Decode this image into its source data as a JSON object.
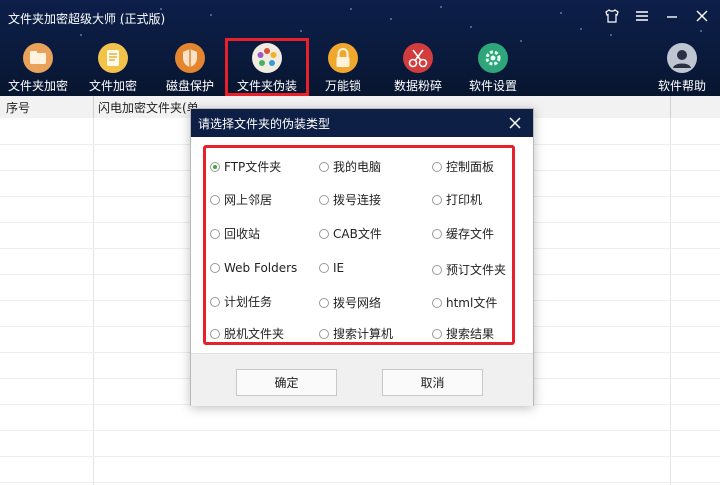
{
  "window": {
    "title": "文件夹加密超级大师 (正式版)",
    "controls": [
      {
        "name": "skin-icon"
      },
      {
        "name": "menu-icon"
      },
      {
        "name": "minimize-icon"
      },
      {
        "name": "close-icon"
      }
    ]
  },
  "toolbar": {
    "items": [
      {
        "label": "文件夹加密",
        "icon": "folder-lock-icon",
        "color": "#e9a25a"
      },
      {
        "label": "文件加密",
        "icon": "file-lock-icon",
        "color": "#f2c24a"
      },
      {
        "label": "磁盘保护",
        "icon": "disk-shield-icon",
        "color": "#e4852f"
      },
      {
        "label": "文件夹伪装",
        "icon": "folder-disguise-icon",
        "color": "#f0ece0",
        "active": true
      },
      {
        "label": "万能锁",
        "icon": "padlock-icon",
        "color": "#f0a72e"
      },
      {
        "label": "数据粉碎",
        "icon": "shredder-icon",
        "color": "#d33c3c"
      },
      {
        "label": "软件设置",
        "icon": "gear-icon",
        "color": "#2fa57a"
      },
      {
        "label": "软件帮助",
        "icon": "user-help-icon",
        "color": "#bfc6d2"
      }
    ],
    "active_outline_color": "#e8202a"
  },
  "table": {
    "headers": [
      "序号",
      "闪电加密文件夹(单"
    ]
  },
  "dialog": {
    "title": "请选择文件夹的伪装类型",
    "options": [
      [
        "FTP文件夹",
        "我的电脑",
        "控制面板"
      ],
      [
        "网上邻居",
        "拨号连接",
        "打印机"
      ],
      [
        "回收站",
        "CAB文件",
        "缓存文件"
      ],
      [
        "Web Folders",
        "IE",
        "预订文件夹"
      ],
      [
        "计划任务",
        "拨号网络",
        "html文件"
      ],
      [
        "脱机文件夹",
        "搜索计算机",
        "搜索结果"
      ]
    ],
    "selected": "FTP文件夹",
    "ok_label": "确定",
    "cancel_label": "取消"
  }
}
